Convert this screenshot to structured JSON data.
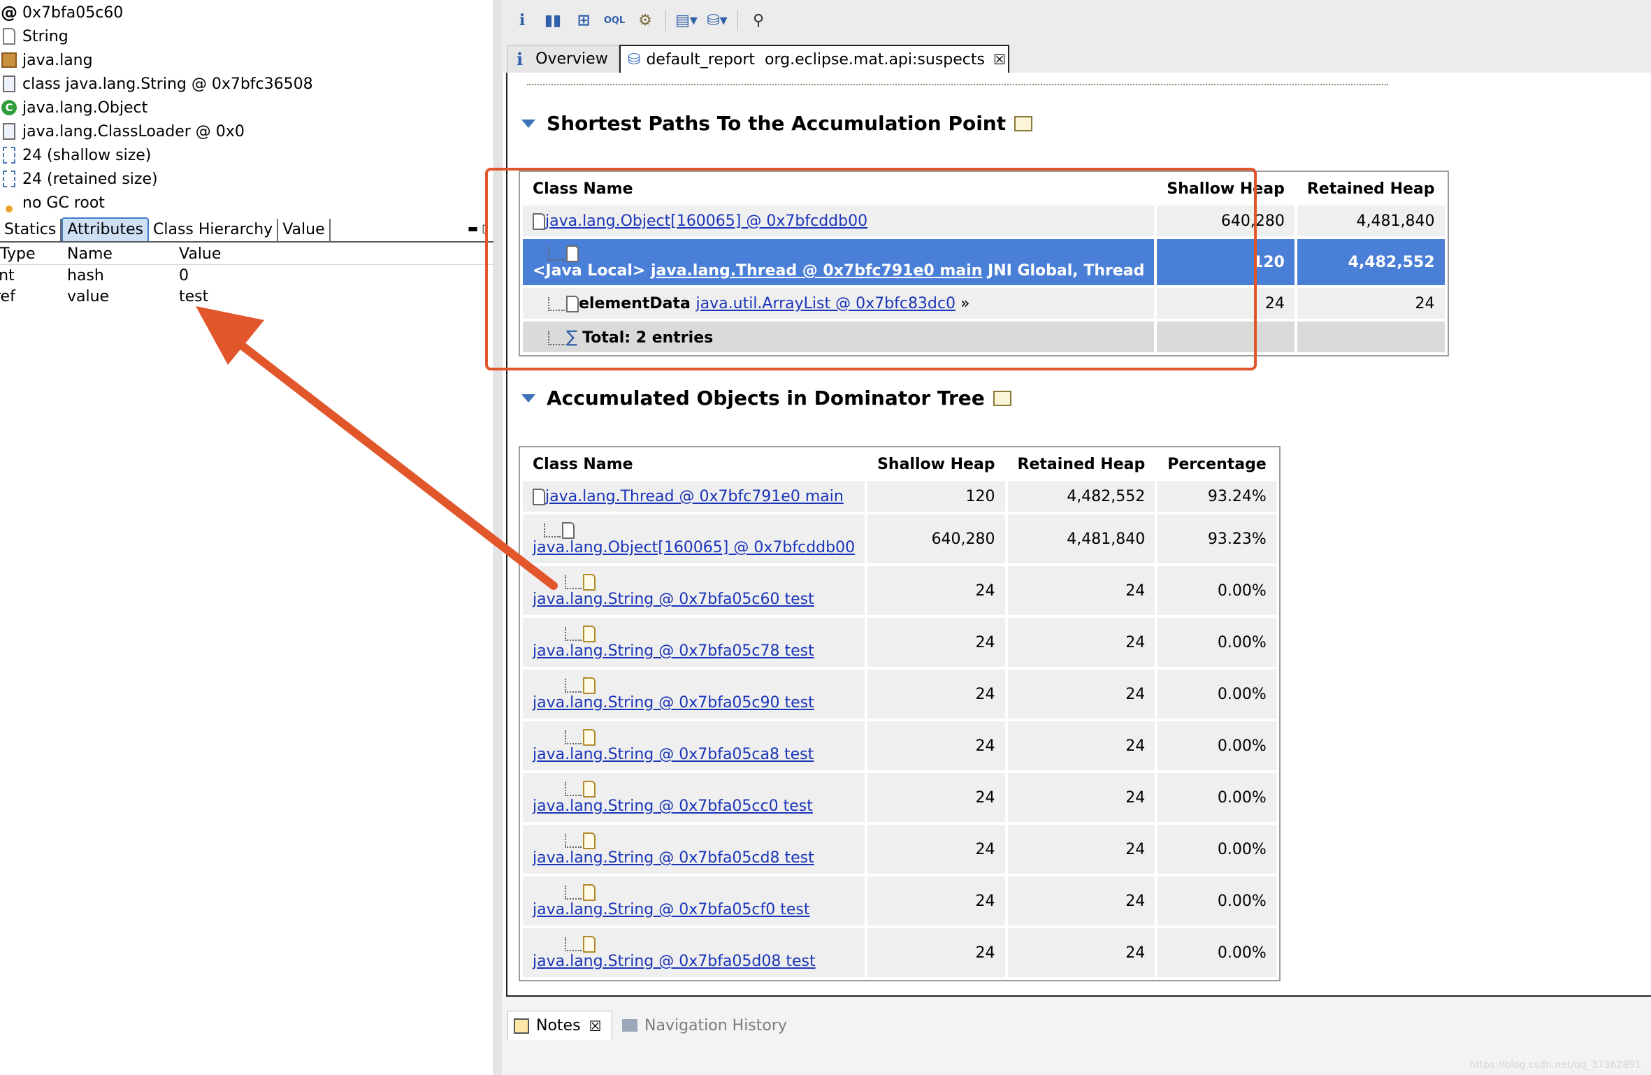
{
  "left": {
    "properties": [
      {
        "icon": "at-icon",
        "text": "0x7bfa05c60"
      },
      {
        "icon": "file-icon",
        "text": "String"
      },
      {
        "icon": "package-icon",
        "text": "java.lang"
      },
      {
        "icon": "class-object-icon",
        "text": "class java.lang.String @ 0x7bfc36508"
      },
      {
        "icon": "class-icon",
        "text": "java.lang.Object"
      },
      {
        "icon": "classloader-icon",
        "text": "java.lang.ClassLoader @ 0x0"
      },
      {
        "icon": "shallow-size-icon",
        "text": "24 (shallow size)"
      },
      {
        "icon": "retained-size-icon",
        "text": "24 (retained size)"
      },
      {
        "icon": "gc-root-icon",
        "text": "no GC root"
      }
    ],
    "tabs": [
      "Statics",
      "Attributes",
      "Class Hierarchy",
      "Value"
    ],
    "active_tab": "Attributes",
    "attributes": {
      "headers": [
        "Type",
        "Name",
        "Value"
      ],
      "rows": [
        {
          "type": "int",
          "name": "hash",
          "value": "0"
        },
        {
          "type": "ref",
          "name": "value",
          "value": "test"
        }
      ]
    }
  },
  "toolbar": {
    "icons": [
      "info-icon",
      "histogram-icon",
      "dominator-tree-icon",
      "oql-icon",
      "thread-overview-icon",
      "run-report-icon",
      "query-browser-icon",
      "search-icon"
    ]
  },
  "editor_tabs": {
    "overview": "Overview",
    "report": "default_report  org.eclipse.mat.api:suspects"
  },
  "section1": {
    "title": "Shortest Paths To the Accumulation Point",
    "headers": [
      "Class Name",
      "Shallow Heap",
      "Retained Heap"
    ],
    "rows": [
      {
        "prefix": "",
        "link": "java.lang.Object[160065] @ 0x7bfcddb00",
        "suffix": "",
        "shallow": "640,280",
        "retained": "4,481,840",
        "selected": false
      },
      {
        "prefix": "<Java Local> ",
        "link": "java.lang.Thread @ 0x7bfc791e0 main",
        "suffix": " JNI Global, Thread",
        "shallow": "120",
        "retained": "4,482,552",
        "selected": true
      },
      {
        "prefix": "elementData ",
        "link": "java.util.ArrayList @ 0x7bfc83dc0",
        "suffix": " »",
        "shallow": "24",
        "retained": "24",
        "selected": false
      }
    ],
    "total": "Total: 2 entries"
  },
  "section2": {
    "title": "Accumulated Objects in Dominator Tree",
    "headers": [
      "Class Name",
      "Shallow Heap",
      "Retained Heap",
      "Percentage"
    ],
    "rows": [
      {
        "link": "java.lang.Thread @ 0x7bfc791e0 main",
        "shallow": "120",
        "retained": "4,482,552",
        "pct": "93.24%"
      },
      {
        "link": "java.lang.Object[160065] @ 0x7bfcddb00",
        "shallow": "640,280",
        "retained": "4,481,840",
        "pct": "93.23%"
      },
      {
        "link": "java.lang.String @ 0x7bfa05c60 test",
        "shallow": "24",
        "retained": "24",
        "pct": "0.00%"
      },
      {
        "link": "java.lang.String @ 0x7bfa05c78 test",
        "shallow": "24",
        "retained": "24",
        "pct": "0.00%"
      },
      {
        "link": "java.lang.String @ 0x7bfa05c90 test",
        "shallow": "24",
        "retained": "24",
        "pct": "0.00%"
      },
      {
        "link": "java.lang.String @ 0x7bfa05ca8 test",
        "shallow": "24",
        "retained": "24",
        "pct": "0.00%"
      },
      {
        "link": "java.lang.String @ 0x7bfa05cc0 test",
        "shallow": "24",
        "retained": "24",
        "pct": "0.00%"
      },
      {
        "link": "java.lang.String @ 0x7bfa05cd8 test",
        "shallow": "24",
        "retained": "24",
        "pct": "0.00%"
      },
      {
        "link": "java.lang.String @ 0x7bfa05cf0 test",
        "shallow": "24",
        "retained": "24",
        "pct": "0.00%"
      },
      {
        "link": "java.lang.String @ 0x7bfa05d08 test",
        "shallow": "24",
        "retained": "24",
        "pct": "0.00%"
      }
    ]
  },
  "bottom_tabs": {
    "notes": "Notes",
    "navigation": "Navigation History"
  },
  "watermark": "https://blog.csdn.net/qq_37362891",
  "colors": {
    "selection": "#4a7fd8",
    "annotation": "#e2562c",
    "link": "#1a35b8"
  }
}
